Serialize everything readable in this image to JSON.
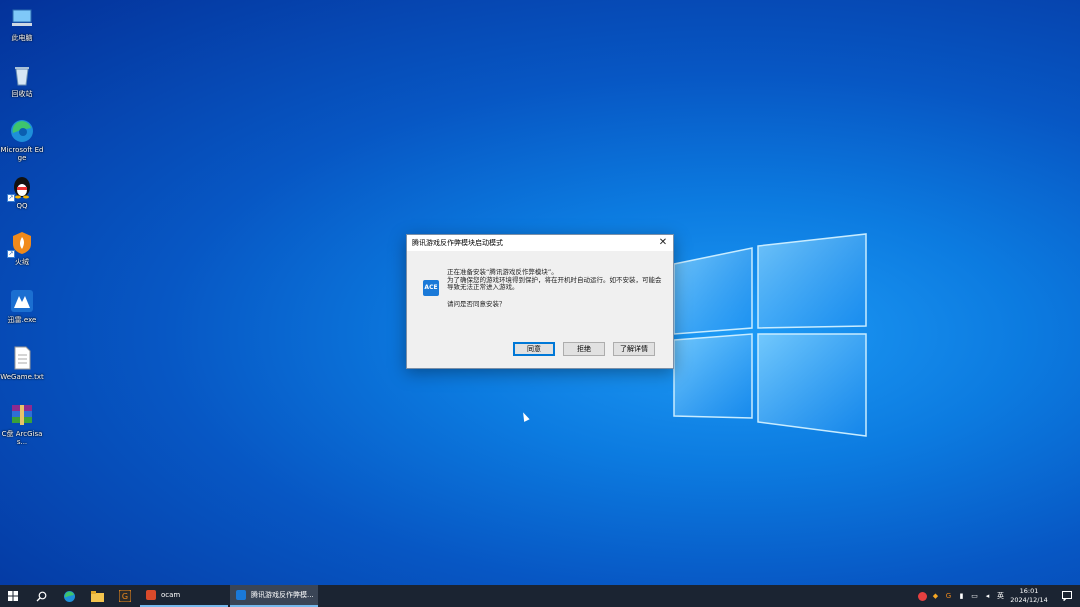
{
  "desktop": {
    "icons": [
      {
        "label": "此电脑"
      },
      {
        "label": "回收站"
      },
      {
        "label": "Microsoft Edge"
      },
      {
        "label": "QQ"
      },
      {
        "label": "火绒"
      },
      {
        "label": "迅雷.exe"
      },
      {
        "label": "WeGame.txt"
      },
      {
        "label": "C盘 ArcGisas..."
      }
    ]
  },
  "dialog": {
    "title": "腾讯游戏反作弊模块启动模式",
    "close_glyph": "✕",
    "icon_text": "ACE",
    "line1": "正在准备安装“腾讯游戏反作弊模块”。",
    "line2": "为了确保您的游戏环境得到保护，将在开机时自动运行。如不安装，可能会导致无法正常进入游戏。",
    "question": "请问是否同意安装？",
    "buttons": {
      "agree": "同意",
      "refuse": "拒绝",
      "details": "了解详情"
    }
  },
  "taskbar": {
    "apps": [
      {
        "label": "ocam"
      },
      {
        "label": "腾讯游戏反作弊模..."
      }
    ],
    "tray": {
      "ime": "英"
    },
    "clock": {
      "time": "16:01",
      "date": "2024/12/14"
    }
  },
  "colors": {
    "desktop_bg": "#0a6fd6",
    "taskbar_bg": "#1b2432",
    "accent": "#0078d7"
  }
}
